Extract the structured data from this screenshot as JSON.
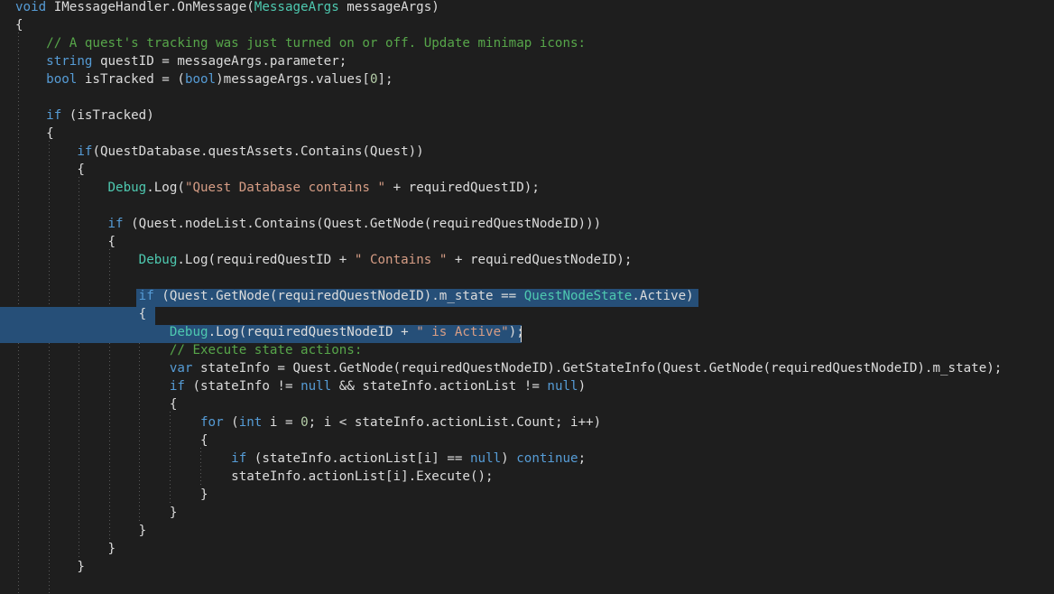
{
  "colors": {
    "background": "#1e1e1e",
    "plain": "#dcdcdc",
    "keyword": "#569cd6",
    "type": "#4ec9b0",
    "string": "#d69d85",
    "comment": "#57a64a",
    "number": "#b5cea8",
    "selection": "#264f78"
  },
  "code": {
    "lines": [
      [
        {
          "t": "void",
          "c": "kw"
        },
        {
          "t": " IMessageHandler.OnMessage(",
          "c": "pl"
        },
        {
          "t": "MessageArgs",
          "c": "ty"
        },
        {
          "t": " messageArgs)",
          "c": "pl"
        }
      ],
      [
        {
          "t": "{",
          "c": "pl"
        }
      ],
      [
        {
          "t": "    ",
          "c": "pl"
        },
        {
          "t": "// A quest's tracking was just turned on or off. Update minimap icons:",
          "c": "cm"
        }
      ],
      [
        {
          "t": "    ",
          "c": "pl"
        },
        {
          "t": "string",
          "c": "kw"
        },
        {
          "t": " questID = messageArgs.parameter;",
          "c": "pl"
        }
      ],
      [
        {
          "t": "    ",
          "c": "pl"
        },
        {
          "t": "bool",
          "c": "kw"
        },
        {
          "t": " isTracked = (",
          "c": "pl"
        },
        {
          "t": "bool",
          "c": "kw"
        },
        {
          "t": ")messageArgs.values[",
          "c": "pl"
        },
        {
          "t": "0",
          "c": "nm"
        },
        {
          "t": "];",
          "c": "pl"
        }
      ],
      [],
      [
        {
          "t": "    ",
          "c": "pl"
        },
        {
          "t": "if",
          "c": "kw"
        },
        {
          "t": " (isTracked)",
          "c": "pl"
        }
      ],
      [
        {
          "t": "    {",
          "c": "pl"
        }
      ],
      [
        {
          "t": "        ",
          "c": "pl"
        },
        {
          "t": "if",
          "c": "kw"
        },
        {
          "t": "(QuestDatabase.questAssets.Contains(Quest))",
          "c": "pl"
        }
      ],
      [
        {
          "t": "        {",
          "c": "pl"
        }
      ],
      [
        {
          "t": "            ",
          "c": "pl"
        },
        {
          "t": "Debug",
          "c": "ty"
        },
        {
          "t": ".Log(",
          "c": "pl"
        },
        {
          "t": "\"Quest Database contains \"",
          "c": "st"
        },
        {
          "t": " + requiredQuestID);",
          "c": "pl"
        }
      ],
      [],
      [
        {
          "t": "            ",
          "c": "pl"
        },
        {
          "t": "if",
          "c": "kw"
        },
        {
          "t": " (Quest.nodeList.Contains(Quest.GetNode(requiredQuestNodeID)))",
          "c": "pl"
        }
      ],
      [
        {
          "t": "            {",
          "c": "pl"
        }
      ],
      [
        {
          "t": "                ",
          "c": "pl"
        },
        {
          "t": "Debug",
          "c": "ty"
        },
        {
          "t": ".Log(requiredQuestID + ",
          "c": "pl"
        },
        {
          "t": "\" Contains \"",
          "c": "st"
        },
        {
          "t": " + requiredQuestNodeID);",
          "c": "pl"
        }
      ],
      [],
      [
        {
          "t": "                ",
          "c": "pl"
        },
        {
          "t": "if",
          "c": "kw"
        },
        {
          "t": " (Quest.GetNode(requiredQuestNodeID).m_state == ",
          "c": "pl"
        },
        {
          "t": "QuestNodeState",
          "c": "ty"
        },
        {
          "t": ".Active)",
          "c": "pl"
        }
      ],
      [
        {
          "t": "                {",
          "c": "pl"
        }
      ],
      [
        {
          "t": "                    ",
          "c": "pl"
        },
        {
          "t": "Debug",
          "c": "ty"
        },
        {
          "t": ".Log(requiredQuestNodeID + ",
          "c": "pl"
        },
        {
          "t": "\" is Active\"",
          "c": "st"
        },
        {
          "t": ");",
          "c": "pl"
        }
      ],
      [
        {
          "t": "                    ",
          "c": "pl"
        },
        {
          "t": "// Execute state actions:",
          "c": "cm"
        }
      ],
      [
        {
          "t": "                    ",
          "c": "pl"
        },
        {
          "t": "var",
          "c": "kw"
        },
        {
          "t": " stateInfo = Quest.GetNode(requiredQuestNodeID).GetStateInfo(Quest.GetNode(requiredQuestNodeID).m_state);",
          "c": "pl"
        }
      ],
      [
        {
          "t": "                    ",
          "c": "pl"
        },
        {
          "t": "if",
          "c": "kw"
        },
        {
          "t": " (stateInfo != ",
          "c": "pl"
        },
        {
          "t": "null",
          "c": "kw"
        },
        {
          "t": " && stateInfo.actionList != ",
          "c": "pl"
        },
        {
          "t": "null",
          "c": "kw"
        },
        {
          "t": ")",
          "c": "pl"
        }
      ],
      [
        {
          "t": "                    {",
          "c": "pl"
        }
      ],
      [
        {
          "t": "                        ",
          "c": "pl"
        },
        {
          "t": "for",
          "c": "kw"
        },
        {
          "t": " (",
          "c": "pl"
        },
        {
          "t": "int",
          "c": "kw"
        },
        {
          "t": " i = ",
          "c": "pl"
        },
        {
          "t": "0",
          "c": "nm"
        },
        {
          "t": "; i < stateInfo.actionList.Count; i++)",
          "c": "pl"
        }
      ],
      [
        {
          "t": "                        {",
          "c": "pl"
        }
      ],
      [
        {
          "t": "                            ",
          "c": "pl"
        },
        {
          "t": "if",
          "c": "kw"
        },
        {
          "t": " (stateInfo.actionList[i] == ",
          "c": "pl"
        },
        {
          "t": "null",
          "c": "kw"
        },
        {
          "t": ") ",
          "c": "pl"
        },
        {
          "t": "continue",
          "c": "kw"
        },
        {
          "t": ";",
          "c": "pl"
        }
      ],
      [
        {
          "t": "                            stateInfo.actionList[i].Execute();",
          "c": "pl"
        }
      ],
      [
        {
          "t": "                        }",
          "c": "pl"
        }
      ],
      [
        {
          "t": "                    }",
          "c": "pl"
        }
      ],
      [
        {
          "t": "                }",
          "c": "pl"
        }
      ],
      [
        {
          "t": "            }",
          "c": "pl"
        }
      ],
      [
        {
          "t": "        }",
          "c": "pl"
        }
      ],
      []
    ]
  }
}
